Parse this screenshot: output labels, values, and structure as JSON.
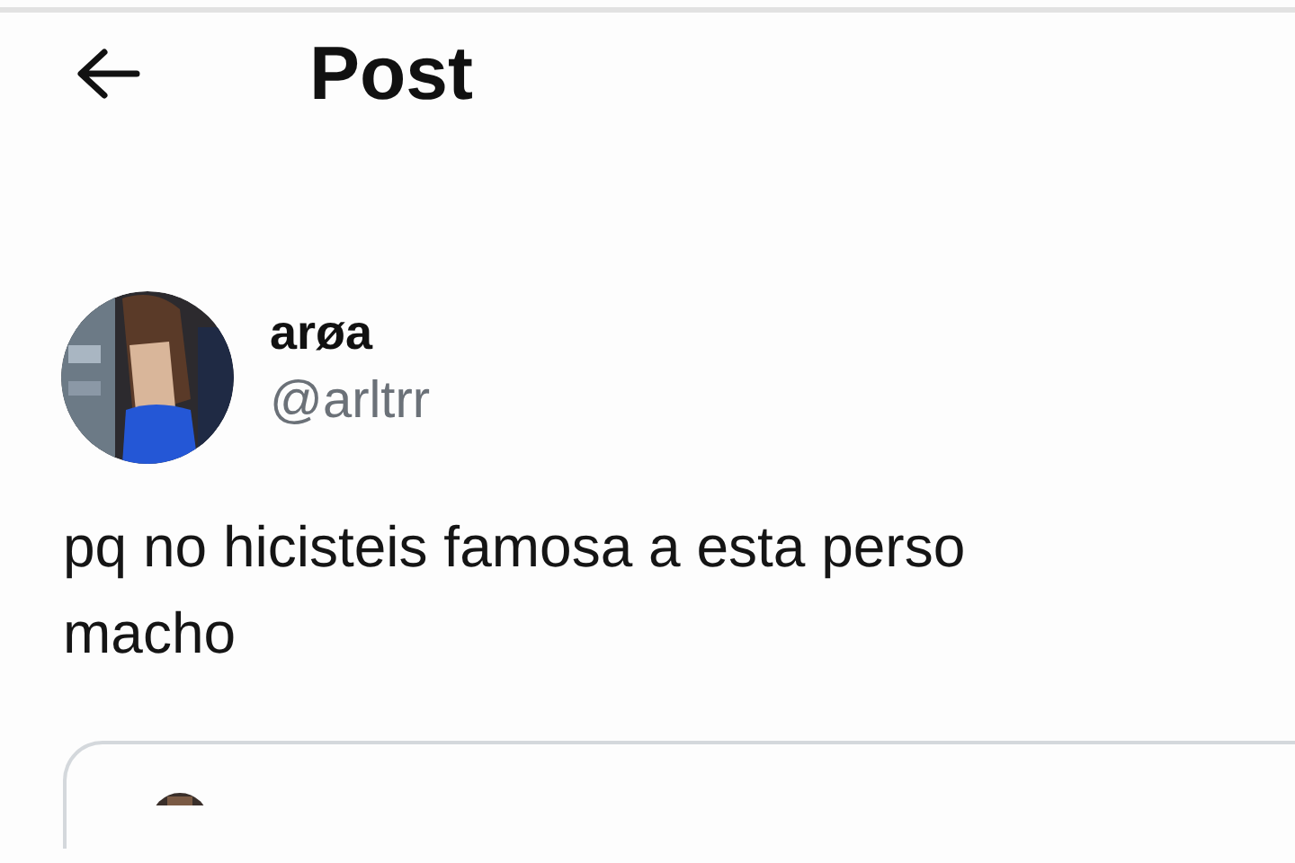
{
  "header": {
    "title": "Post"
  },
  "post": {
    "author": {
      "name": "arøa",
      "handle": "@arltrr"
    },
    "text_lines": [
      "pq no hicisteis famosa a esta perso",
      "macho"
    ]
  }
}
